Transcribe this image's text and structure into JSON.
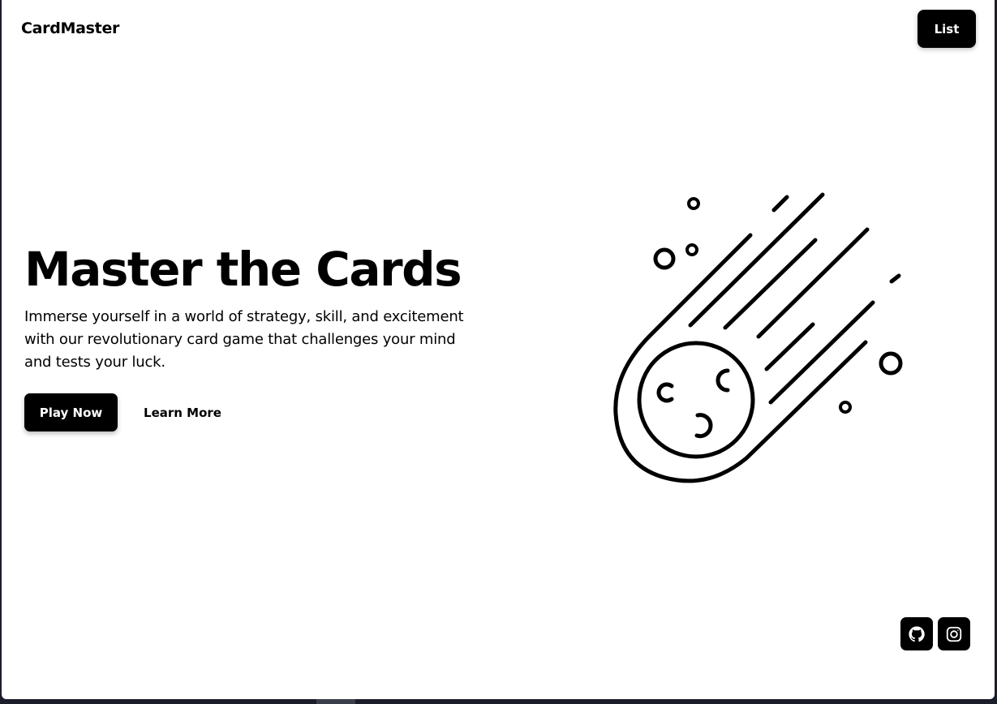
{
  "header": {
    "brand": "CardMaster",
    "list_button": "List"
  },
  "hero": {
    "title": "Master the Cards",
    "description": "Immerse yourself in a world of strategy, skill, and excitement with our revolutionary card game that challenges your mind and tests your luck.",
    "primary_button": "Play Now",
    "secondary_button": "Learn More"
  },
  "illustration": {
    "icon": "meteor-icon"
  },
  "social": [
    {
      "icon": "github-icon"
    },
    {
      "icon": "instagram-icon"
    }
  ],
  "colors": {
    "background": "#ffffff",
    "button": "#000000",
    "button_text": "#ffffff",
    "frame": "#1b1d2a"
  }
}
